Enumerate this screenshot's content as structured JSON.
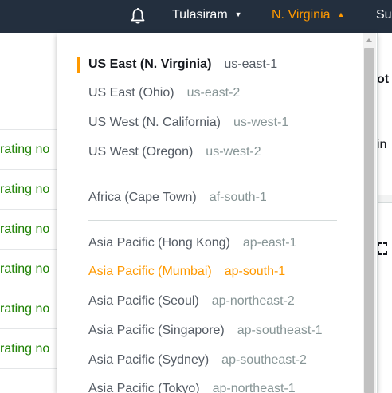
{
  "nav": {
    "user": "Tulasiram",
    "region": "N. Virginia",
    "support": "Su"
  },
  "background": {
    "row_text": "rating no",
    "right_texts": [
      "ot",
      "in"
    ],
    "right_icon": "expand-icon"
  },
  "regions": [
    {
      "name": "US East (N. Virginia)",
      "code": "us-east-1",
      "selected": true
    },
    {
      "name": "US East (Ohio)",
      "code": "us-east-2"
    },
    {
      "name": "US West (N. California)",
      "code": "us-west-1"
    },
    {
      "name": "US West (Oregon)",
      "code": "us-west-2"
    },
    {
      "name": "Africa (Cape Town)",
      "code": "af-south-1"
    },
    {
      "name": "Asia Pacific (Hong Kong)",
      "code": "ap-east-1"
    },
    {
      "name": "Asia Pacific (Mumbai)",
      "code": "ap-south-1",
      "hovered": true
    },
    {
      "name": "Asia Pacific (Seoul)",
      "code": "ap-northeast-2"
    },
    {
      "name": "Asia Pacific (Singapore)",
      "code": "ap-southeast-1"
    },
    {
      "name": "Asia Pacific (Sydney)",
      "code": "ap-southeast-2"
    },
    {
      "name": "Asia Pacific (Tokyo)",
      "code": "ap-northeast-1"
    }
  ],
  "colors": {
    "nav_bg": "#232f3e",
    "accent": "#ff9900",
    "status_green": "#1d8102"
  }
}
